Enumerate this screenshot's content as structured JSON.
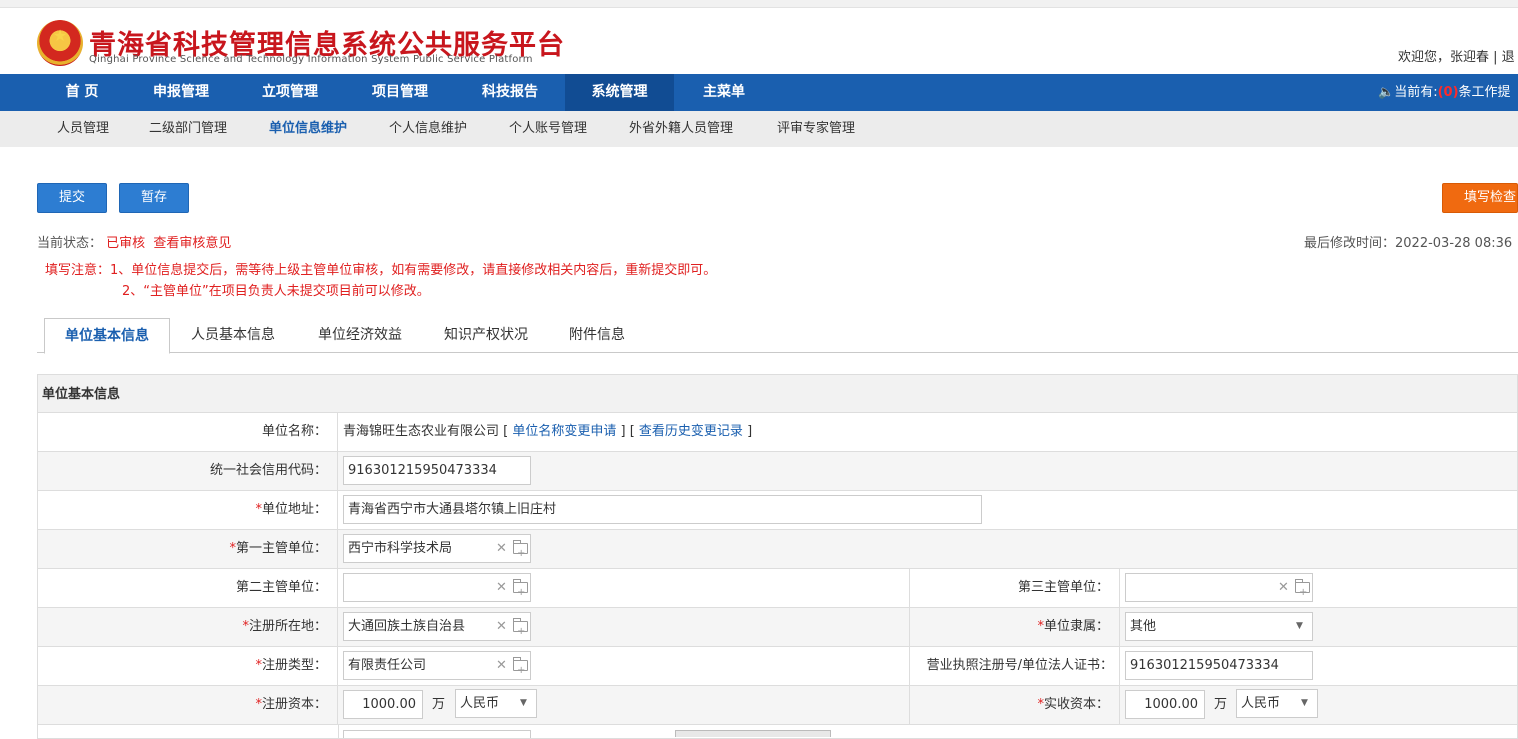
{
  "header": {
    "title": "青海省科技管理信息系统公共服务平台",
    "subtitle": "Qinghai Province Science and Technology Information System Public Service Platform",
    "welcome": "欢迎您，张迎春 | 退"
  },
  "nav": {
    "items": [
      "首 页",
      "申报管理",
      "立项管理",
      "项目管理",
      "科技报告",
      "系统管理",
      "主菜单"
    ],
    "notice_prefix": "当前有:",
    "notice_count": "(0)",
    "notice_suffix": "条工作提"
  },
  "subnav": {
    "items": [
      "人员管理",
      "二级部门管理",
      "单位信息维护",
      "个人信息维护",
      "个人账号管理",
      "外省外籍人员管理",
      "评审专家管理"
    ]
  },
  "toolbar": {
    "submit_label": "提交",
    "save_label": "暂存",
    "check_label": "填写检查"
  },
  "status": {
    "label": "当前状态：",
    "value": "已审核",
    "view_opinion": "查看审核意见",
    "modified": "最后修改时间：2022-03-28 08:36"
  },
  "notice": {
    "line1": "填写注意：1、单位信息提交后，需等待上级主管单位审核，如有需要修改，请直接修改相关内容后，重新提交即可。",
    "line2": "2、“主管单位”在项目负责人未提交项目前可以修改。"
  },
  "tabs": [
    "单位基本信息",
    "人员基本信息",
    "单位经济效益",
    "知识产权状况",
    "附件信息"
  ],
  "form": {
    "section_title": "单位基本信息",
    "unit_name_label": "单位名称：",
    "unit_name_value": "青海锦旺生态农业有限公司",
    "unit_name_change": "单位名称变更申请",
    "unit_name_history": "查看历史变更记录",
    "credit_code_label": "统一社会信用代码：",
    "credit_code_value": "916301215950473334",
    "address_label": "单位地址：",
    "address_value": "青海省西宁市大通县塔尔镇上旧庄村",
    "supervisor1_label": "第一主管单位：",
    "supervisor1_value": "西宁市科学技术局",
    "supervisor2_label": "第二主管单位：",
    "supervisor2_value": "",
    "supervisor3_label": "第三主管单位：",
    "supervisor3_value": "",
    "reg_place_label": "注册所在地：",
    "reg_place_value": "大通回族土族自治县",
    "affiliation_label": "单位隶属：",
    "affiliation_value": "其他",
    "reg_type_label": "注册类型：",
    "reg_type_value": "有限责任公司",
    "license_label": "营业执照注册号/单位法人证书：",
    "license_value": "916301215950473334",
    "reg_capital_label": "注册资本：",
    "reg_capital_value": "1000.00",
    "reg_capital_unit": "万",
    "reg_capital_currency": "人民币",
    "paid_capital_label": "实收资本：",
    "paid_capital_value": "1000.00",
    "paid_capital_unit": "万",
    "paid_capital_currency": "人民币"
  },
  "colors": {
    "nav_blue": "#1a5faf",
    "title_red": "#c8161d",
    "button_orange": "#f06a10"
  }
}
